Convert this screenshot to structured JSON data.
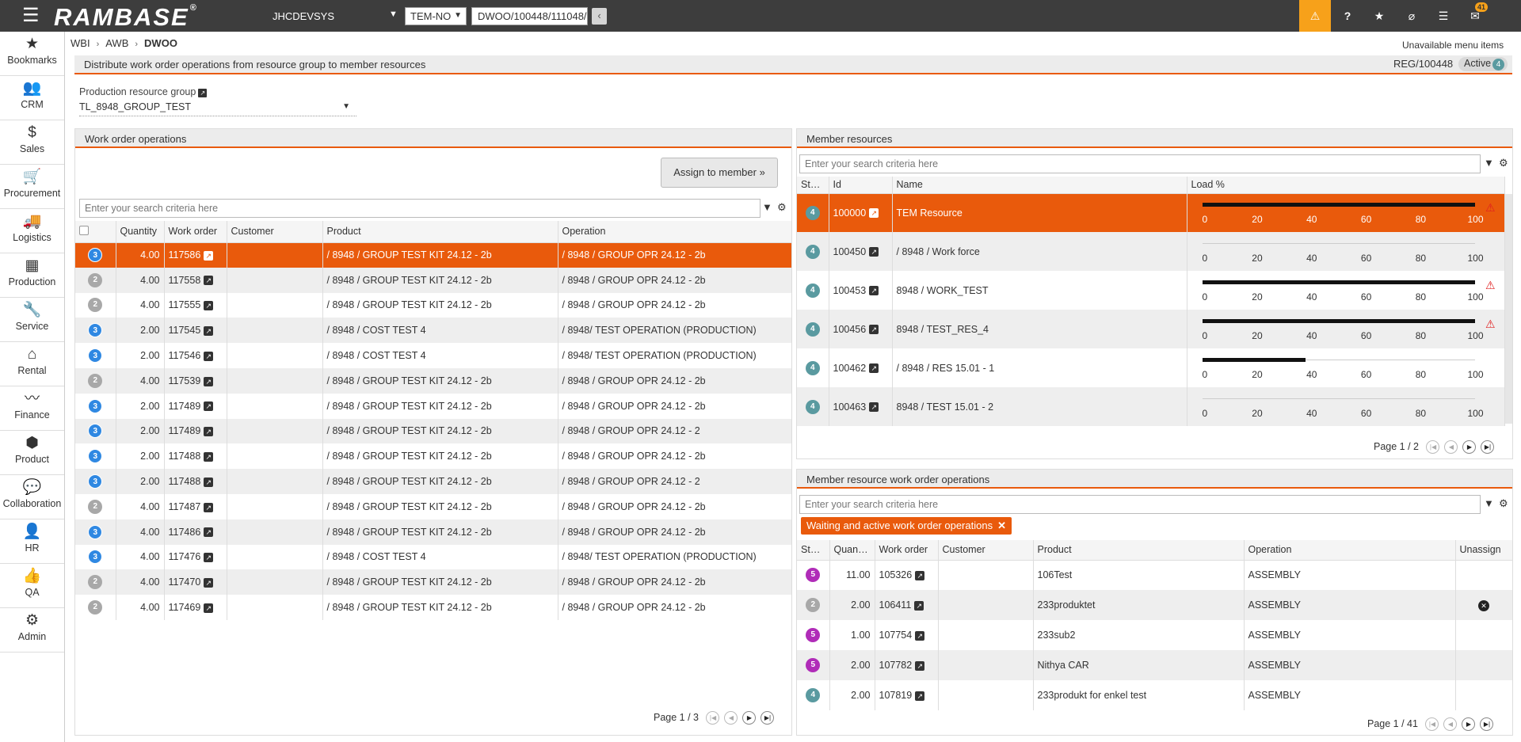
{
  "topbar": {
    "logo": "RAMBASE",
    "logo_mark": "®",
    "system": "JHCDEVSYS",
    "company": "TEM-NO",
    "address": "DWOO/100448/111048/",
    "notif_count": "41"
  },
  "sidebar": {
    "items": [
      {
        "label": "Bookmarks",
        "icon": "star-icon"
      },
      {
        "label": "CRM",
        "icon": "people-icon"
      },
      {
        "label": "Sales",
        "icon": "money-bag-icon"
      },
      {
        "label": "Procurement",
        "icon": "cart-icon"
      },
      {
        "label": "Logistics",
        "icon": "truck-icon"
      },
      {
        "label": "Production",
        "icon": "boxes-icon"
      },
      {
        "label": "Service",
        "icon": "wrench-icon"
      },
      {
        "label": "Rental",
        "icon": "rental-icon"
      },
      {
        "label": "Finance",
        "icon": "chart-line-icon"
      },
      {
        "label": "Product",
        "icon": "box-icon"
      },
      {
        "label": "Collaboration",
        "icon": "chat-icon"
      },
      {
        "label": "HR",
        "icon": "person-icon"
      },
      {
        "label": "QA",
        "icon": "thumbs-up-icon"
      },
      {
        "label": "Admin",
        "icon": "gear-icon"
      }
    ]
  },
  "breadcrumb": {
    "items": [
      "WBI",
      "AWB",
      "DWOO"
    ]
  },
  "unavailable_menu": "Unavailable menu items",
  "page": {
    "title": "Distribute work order operations from resource group to member resources",
    "reg_id": "REG/100448",
    "status_label": "Active",
    "status_num": "4"
  },
  "production_group": {
    "label": "Production resource group",
    "value": "TL_8948_GROUP_TEST"
  },
  "work_order_ops": {
    "title": "Work order operations",
    "assign_label": "Assign to member",
    "search_placeholder": "Enter your search criteria here",
    "columns": [
      "Quantity",
      "Work order",
      "Customer",
      "Product",
      "Operation"
    ],
    "rows": [
      {
        "status": "3",
        "quantity": "4.00",
        "work_order": "117586",
        "customer": "",
        "product": "/ 8948 / GROUP TEST KIT 24.12 - 2b",
        "operation": "/ 8948 / GROUP OPR 24.12 - 2b"
      },
      {
        "status": "2",
        "quantity": "4.00",
        "work_order": "117558",
        "customer": "",
        "product": "/ 8948 / GROUP TEST KIT 24.12 - 2b",
        "operation": "/ 8948 / GROUP OPR 24.12 - 2b"
      },
      {
        "status": "2",
        "quantity": "4.00",
        "work_order": "117555",
        "customer": "",
        "product": "/ 8948 / GROUP TEST KIT 24.12 - 2b",
        "operation": "/ 8948 / GROUP OPR 24.12 - 2b"
      },
      {
        "status": "3",
        "quantity": "2.00",
        "work_order": "117545",
        "customer": "",
        "product": "/ 8948 / COST TEST 4",
        "operation": "/ 8948/ TEST OPERATION (PRODUCTION)"
      },
      {
        "status": "3",
        "quantity": "2.00",
        "work_order": "117546",
        "customer": "",
        "product": "/ 8948 / COST TEST 4",
        "operation": "/ 8948/ TEST OPERATION (PRODUCTION)"
      },
      {
        "status": "2",
        "quantity": "4.00",
        "work_order": "117539",
        "customer": "",
        "product": "/ 8948 / GROUP TEST KIT 24.12 - 2b",
        "operation": "/ 8948 / GROUP OPR 24.12 - 2b"
      },
      {
        "status": "3",
        "quantity": "2.00",
        "work_order": "117489",
        "customer": "",
        "product": "/ 8948 / GROUP TEST KIT 24.12 - 2b",
        "operation": "/ 8948 / GROUP OPR 24.12 - 2b"
      },
      {
        "status": "3",
        "quantity": "2.00",
        "work_order": "117489",
        "customer": "",
        "product": "/ 8948 / GROUP TEST KIT 24.12 - 2b",
        "operation": "/ 8948 / GROUP OPR 24.12 - 2"
      },
      {
        "status": "3",
        "quantity": "2.00",
        "work_order": "117488",
        "customer": "",
        "product": "/ 8948 / GROUP TEST KIT 24.12 - 2b",
        "operation": "/ 8948 / GROUP OPR 24.12 - 2b"
      },
      {
        "status": "3",
        "quantity": "2.00",
        "work_order": "117488",
        "customer": "",
        "product": "/ 8948 / GROUP TEST KIT 24.12 - 2b",
        "operation": "/ 8948 / GROUP OPR 24.12 - 2"
      },
      {
        "status": "2",
        "quantity": "4.00",
        "work_order": "117487",
        "customer": "",
        "product": "/ 8948 / GROUP TEST KIT 24.12 - 2b",
        "operation": "/ 8948 / GROUP OPR 24.12 - 2b"
      },
      {
        "status": "3",
        "quantity": "4.00",
        "work_order": "117486",
        "customer": "",
        "product": "/ 8948 / GROUP TEST KIT 24.12 - 2b",
        "operation": "/ 8948 / GROUP OPR 24.12 - 2b"
      },
      {
        "status": "3",
        "quantity": "4.00",
        "work_order": "117476",
        "customer": "",
        "product": "/ 8948 / COST TEST 4",
        "operation": "/ 8948/ TEST OPERATION (PRODUCTION)"
      },
      {
        "status": "2",
        "quantity": "4.00",
        "work_order": "117470",
        "customer": "",
        "product": "/ 8948 / GROUP TEST KIT 24.12 - 2b",
        "operation": "/ 8948 / GROUP OPR 24.12 - 2b"
      },
      {
        "status": "2",
        "quantity": "4.00",
        "work_order": "117469",
        "customer": "",
        "product": "/ 8948 / GROUP TEST KIT 24.12 - 2b",
        "operation": "/ 8948 / GROUP OPR 24.12 - 2b"
      }
    ],
    "pager": "Page 1 / 3"
  },
  "member_resources": {
    "title": "Member resources",
    "search_placeholder": "Enter your search criteria here",
    "columns": [
      "Status",
      "Id",
      "Name",
      "Load %"
    ],
    "ticks": [
      "0",
      "20",
      "40",
      "60",
      "80",
      "100"
    ],
    "rows": [
      {
        "status": "4",
        "id": "100000",
        "name": "TEM Resource",
        "load_pct": 100,
        "warn": true
      },
      {
        "status": "4",
        "id": "100450",
        "name": "/ 8948 / Work force",
        "load_pct": 0,
        "warn": false
      },
      {
        "status": "4",
        "id": "100453",
        "name": "8948 / WORK_TEST",
        "load_pct": 100,
        "warn": true
      },
      {
        "status": "4",
        "id": "100456",
        "name": "8948 / TEST_RES_4",
        "load_pct": 100,
        "warn": true
      },
      {
        "status": "4",
        "id": "100462",
        "name": "/ 8948 / RES 15.01 - 1",
        "load_pct": 38,
        "warn": false
      },
      {
        "status": "4",
        "id": "100463",
        "name": "8948 / TEST 15.01 - 2",
        "load_pct": 0,
        "warn": false
      }
    ],
    "pager": "Page 1 / 2"
  },
  "member_wo_ops": {
    "title": "Member resource work order operations",
    "search_placeholder": "Enter your search criteria here",
    "filter_chip": "Waiting and active work order operations",
    "columns": [
      "Status",
      "Quantity",
      "Work order",
      "Customer",
      "Product",
      "Operation",
      "Unassign"
    ],
    "rows": [
      {
        "status": "5",
        "quantity": "11.00",
        "work_order": "105326",
        "customer": "",
        "product": "106Test",
        "operation": "ASSEMBLY",
        "unassign": false
      },
      {
        "status": "2",
        "quantity": "2.00",
        "work_order": "106411",
        "customer": "",
        "product": "233produktet",
        "operation": "ASSEMBLY",
        "unassign": true
      },
      {
        "status": "5",
        "quantity": "1.00",
        "work_order": "107754",
        "customer": "",
        "product": "233sub2",
        "operation": "ASSEMBLY",
        "unassign": false
      },
      {
        "status": "5",
        "quantity": "2.00",
        "work_order": "107782",
        "customer": "",
        "product": "Nithya CAR",
        "operation": "ASSEMBLY",
        "unassign": false
      },
      {
        "status": "4",
        "quantity": "2.00",
        "work_order": "107819",
        "customer": "",
        "product": "233produkt for enkel test",
        "operation": "ASSEMBLY",
        "unassign": false
      }
    ],
    "pager": "Page 1 / 41"
  },
  "colors": {
    "accent": "#e95a0c",
    "topbar": "#3d3d3d",
    "alert": "#f7a11a"
  }
}
